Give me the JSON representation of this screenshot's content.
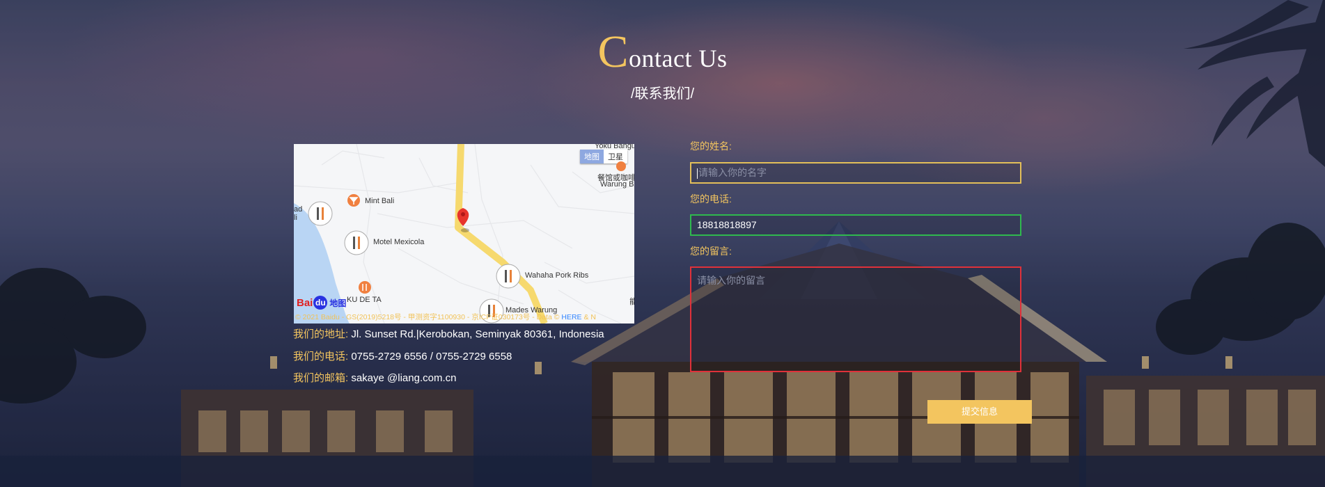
{
  "header": {
    "title_initial": "C",
    "title_rest": "ontact Us",
    "subtitle": "/联系我们/"
  },
  "map": {
    "type_toggle": [
      "地图",
      "卫星"
    ],
    "labels": {
      "mint_bali": "Mint Bali",
      "motel_mexicola": "Motel Mexicola",
      "wahaha": "Wahaha Pork Ribs",
      "ku_de_ta": "KU DE TA",
      "mades_warung": "Mades Warung",
      "yoku": "Yoku Bangunan",
      "cafe": "餐馆或咖啡",
      "warung_b": "Warung B",
      "left_ad": "ad",
      "left_li": "li",
      "right_edge": "能"
    },
    "logo_text": "Bai",
    "logo_paw": "du",
    "logo_suffix": "地图",
    "copyright": "© 2021 Baidu - GS(2019)5218号 - 甲测资字1100930 - 京ICP证030173号 - Data © ",
    "copyright_link": "HERE",
    "copyright_tail": " & N"
  },
  "contact": {
    "address_label": "我们的地址:",
    "address": " Jl. Sunset Rd.|Kerobokan, Seminyak 80361, Indonesia",
    "phone_label": "我们的电话:",
    "phone": " 0755-2729 6556 / 0755-2729 6558",
    "email_label": "我们的邮箱:",
    "email": " sakaye @liang.com.cn"
  },
  "form": {
    "name_label": "您的姓名:",
    "name_placeholder": "请输入你的名字",
    "phone_label": "您的电话:",
    "phone_value": "18818818897",
    "message_label": "您的留言:",
    "message_placeholder": "请输入你的留言",
    "submit_label": "提交信息"
  },
  "colors": {
    "accent": "#f3c55f",
    "name_border": "#e3bf59",
    "phone_border": "#2fb94e",
    "message_border": "#e0313a"
  }
}
